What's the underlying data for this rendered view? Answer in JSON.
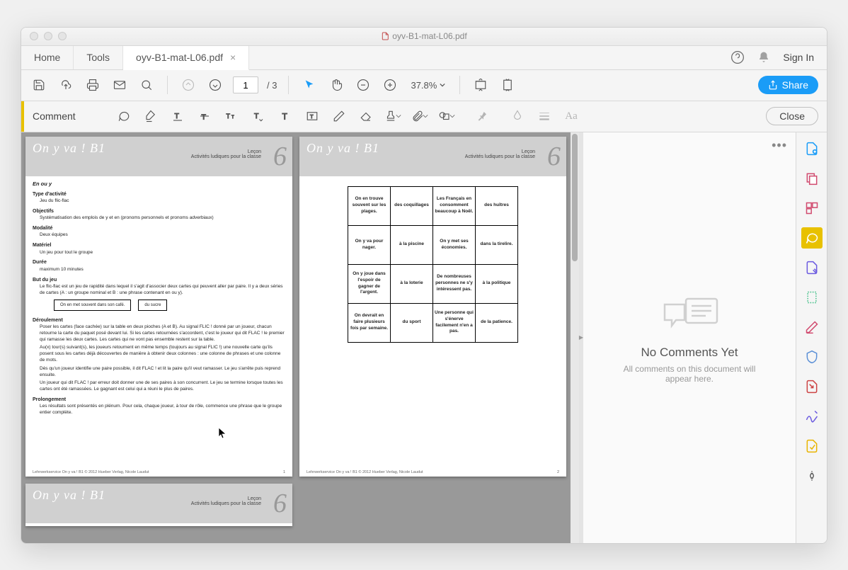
{
  "window": {
    "title": "oyv-B1-mat-L06.pdf"
  },
  "tabs": {
    "home": "Home",
    "tools": "Tools",
    "file": "oyv-B1-mat-L06.pdf",
    "help_aria": "Help",
    "notif_aria": "Notifications",
    "signin": "Sign In"
  },
  "toolbar": {
    "save": "Save",
    "cloud": "Cloud",
    "print": "Print",
    "email": "Email",
    "find": "Find",
    "up": "Previous page",
    "down": "Next page",
    "page_current": "1",
    "page_total": "/ 3",
    "select": "Select",
    "hand": "Hand",
    "zoom_out": "Zoom out",
    "zoom_in": "Zoom in",
    "zoom_level": "37.8%",
    "fit_width": "Fit width",
    "fit_page": "Fit page",
    "share": "Share"
  },
  "commentbar": {
    "label": "Comment",
    "close": "Close",
    "sticky": "Sticky note",
    "highlight": "Highlight",
    "underline": "Underline",
    "strike": "Strikethrough",
    "replace": "Replace text",
    "insert": "Insert text",
    "text": "Add text",
    "textbox": "Text box",
    "pencil": "Draw",
    "eraser": "Erase",
    "stamp": "Stamp",
    "attach": "Attach",
    "draw": "Drawing tools",
    "pin": "Pin",
    "color": "Color",
    "lines": "Line width",
    "font": "Font"
  },
  "doc": {
    "series": "On y va ! B1",
    "lecon": "Leçon",
    "activites": "Activités ludiques pour la classe",
    "six": "6",
    "page1": {
      "section": "En ou y",
      "labels": {
        "type": "Type d'activité",
        "objectifs": "Objectifs",
        "modalite": "Modalité",
        "materiel": "Matériel",
        "duree": "Durée",
        "but": "But du jeu",
        "deroulement": "Déroulement",
        "prolongement": "Prolongement"
      },
      "type_text": "Jeu du flic-flac",
      "objectifs_text": "Systématisation des emplois de y et en (pronoms personnels et pronoms adverbiaux)",
      "modalite_text": "Deux équipes",
      "materiel_text": "Un jeu pour tout le groupe",
      "duree_text": "maximum 10 minutes",
      "but_text": "Le flic-flac est un jeu de rapidité dans lequel il s'agit d'associer deux cartes qui peuvent aller par paire. Il y a deux séries de cartes (A : un groupe nominal et B : une phrase contenant en ou y).",
      "card_a": "On en met souvent dans son café.",
      "card_b": "du sucre",
      "deroul1": "Poser les cartes (face cachée) sur la table en deux pioches (A et B). Au signal FLIC ! donné par un joueur, chacun retourne la carte du paquet posé devant lui. Si les cartes retournées s'accordent, c'est le joueur qui dit FLAC ! le premier qui ramasse les deux cartes. Les cartes qui ne vont pas ensemble restent sur la table.",
      "deroul2": "Au(x) tour(s) suivant(s), les joueurs retournent en même temps (toujours au signal FLIC !) une nouvelle carte qu'ils posent sous les cartes déjà découvertes de manière à obtenir deux colonnes : une colonne de phrases et une colonne de mots.",
      "deroul3": "Dès qu'un joueur identifie une paire possible, il dit FLAC ! et lit la paire qu'il veut ramasser. Le jeu s'arrête puis reprend ensuite.",
      "deroul4": "Un joueur qui dit FLAC ! par erreur doit donner une de ses paires à son concurrent. Le jeu se termine lorsque toutes les cartes ont été ramassées. Le gagnant est celui qui a réuni le plus de paires.",
      "prolong_text": "Les résultats sont présentés en plénum. Pour cela, chaque joueur, à tour de rôle, commence une phrase que le groupe entier complète.",
      "footer": "Lehrwerkservice On y va ! B1 © 2012 Hueber Verlag, Nicole Laudut",
      "pnum": "1"
    },
    "page2": {
      "grid": [
        [
          "On en trouve souvent sur les plages.",
          "des coquillages",
          "Les Français en consomment beaucoup à Noël.",
          "des huîtres"
        ],
        [
          "On y va pour nager.",
          "à la piscine",
          "On y met ses économies.",
          "dans la tirelire."
        ],
        [
          "On y joue dans l'espoir de gagner de l'argent.",
          "à la loterie",
          "De nombreuses personnes ne s'y intéressent pas.",
          "à la politique"
        ],
        [
          "On devrait en faire plusieurs fois par semaine.",
          "du sport",
          "Une personne qui s'énerve facilement n'en a pas.",
          "de la patience."
        ]
      ],
      "footer": "Lehrwerkservice On y va ! B1 © 2012 Hueber Verlag, Nicole Laudut",
      "pnum": "2"
    }
  },
  "comments": {
    "menu_aria": "Comments menu",
    "title": "No Comments Yet",
    "sub": "All comments on this document will appear here."
  },
  "rail": {
    "create": "Create PDF",
    "combine": "Combine",
    "organize": "Organize",
    "comment": "Comment",
    "fill": "Fill & Sign",
    "measure": "Measure",
    "edit": "Edit",
    "protect": "Protect",
    "export": "Export",
    "sign": "Sign",
    "send": "Send",
    "more": "More tools"
  }
}
